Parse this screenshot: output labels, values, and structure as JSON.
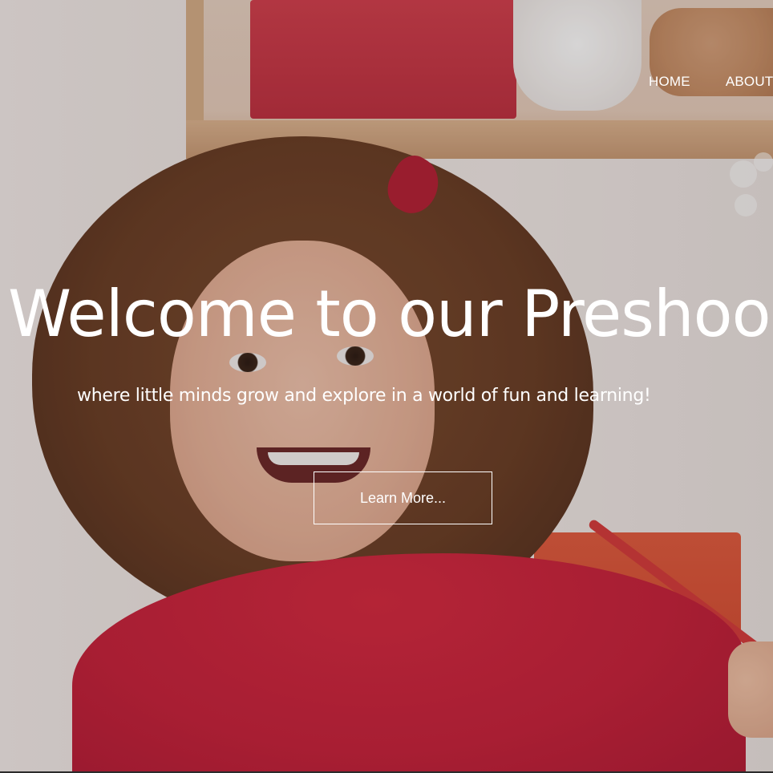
{
  "nav": {
    "items": [
      "HOME",
      "ABOUT"
    ]
  },
  "hero": {
    "title": "Welcome to our Preshool",
    "subtitle": "where little minds grow and explore in a world of fun and learning!",
    "cta_label": "Learn More..."
  },
  "colors": {
    "text": "#ffffff",
    "sweater_red": "#c7203a",
    "accent_orange": "#e25a3d"
  }
}
